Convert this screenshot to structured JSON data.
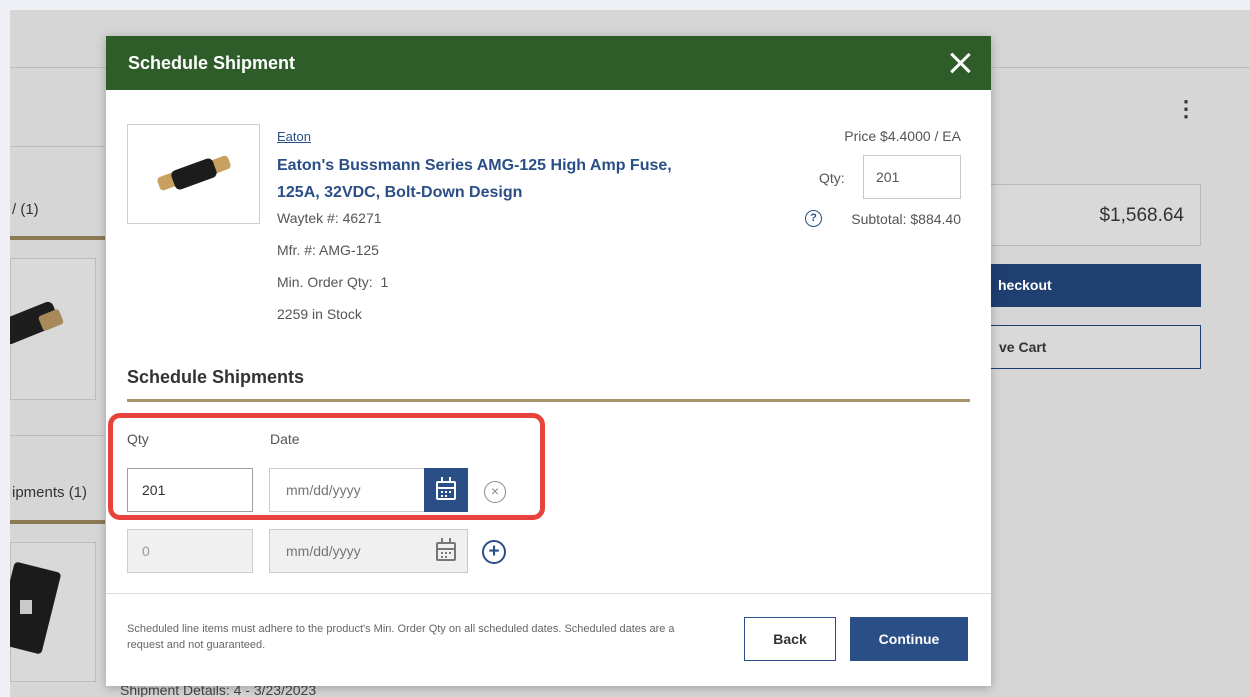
{
  "background": {
    "cart_total": "$1,568.64",
    "checkout_label": "heckout",
    "save_cart_label": "ve Cart",
    "section_1_label": "/ (1)",
    "section_2_label": "ipments (1)",
    "shipment_details": "Shipment Details: 4 - 3/23/2023",
    "kebab": "⋮"
  },
  "modal": {
    "title": "Schedule Shipment",
    "close_icon": "close-icon",
    "product": {
      "brand": "Eaton",
      "name": "Eaton's Bussmann Series AMG-125 High Amp Fuse, 125A, 32VDC, Bolt-Down Design",
      "waytek_no": "Waytek #: 46271",
      "mfr_no": "Mfr. #: AMG-125",
      "min_order_qty": "Min. Order Qty:  1",
      "stock": "2259 in Stock",
      "price": "Price $4.4000 / EA",
      "qty_label": "Qty:",
      "qty_value": "201",
      "subtotal": "Subtotal: $884.40"
    },
    "schedule": {
      "section_title": "Schedule Shipments",
      "qty_header": "Qty",
      "date_header": "Date",
      "rows": [
        {
          "qty": "201",
          "date_placeholder": "mm/dd/yyyy"
        },
        {
          "qty": "0",
          "date_placeholder": "mm/dd/yyyy"
        }
      ]
    },
    "footer": {
      "note": "Scheduled line items must adhere to the product's Min. Order Qty on all scheduled dates. Scheduled dates are a request and not guaranteed.",
      "back_label": "Back",
      "continue_label": "Continue"
    }
  },
  "colors": {
    "header_green": "#2f5d2a",
    "primary_blue": "#2a4e86",
    "gold_rule": "#a89468",
    "highlight_red": "#e8423d"
  }
}
